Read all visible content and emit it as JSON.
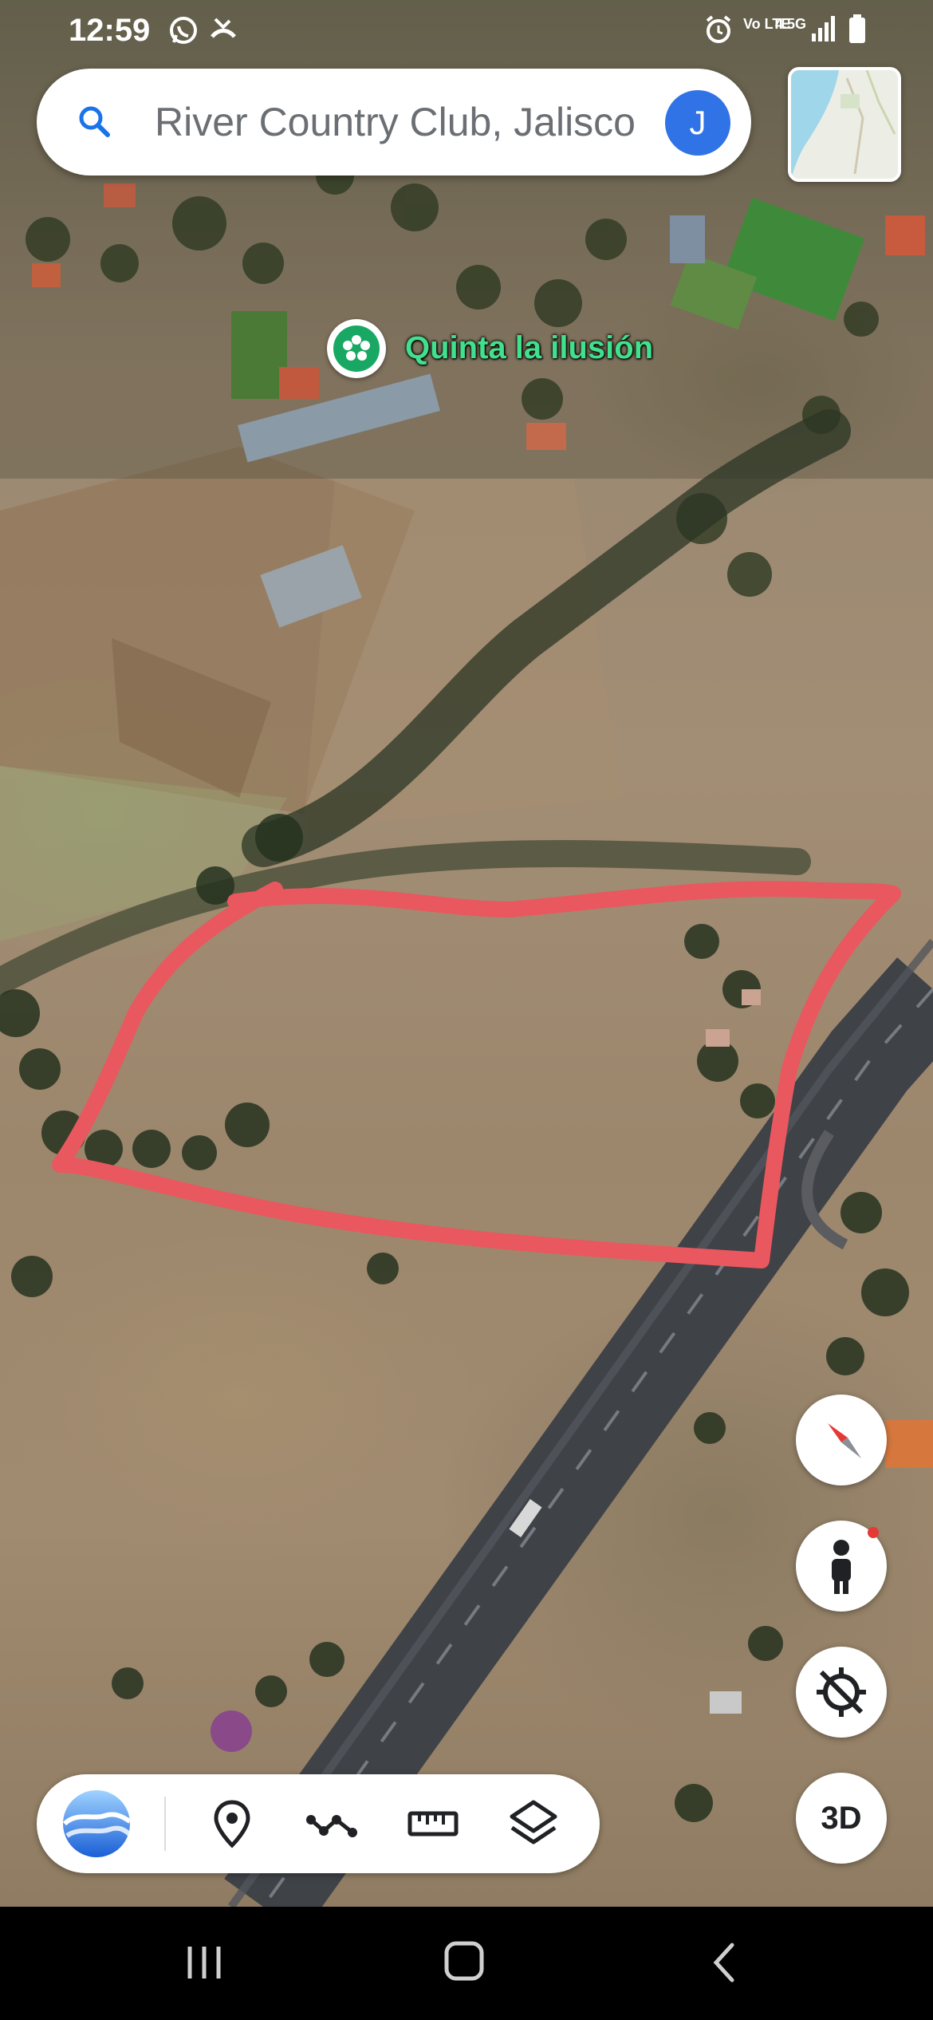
{
  "status_bar": {
    "time": "12:59",
    "network": "Vo LTE",
    "network_speed": "4.5G"
  },
  "search": {
    "text": "River Country Club, Jalisco",
    "account_initial": "J"
  },
  "map": {
    "place_label": "Quinta la ilusión",
    "place_pin_color": "#19a864",
    "annotation_color": "#e9585e"
  },
  "map_controls": {
    "compass_icon": "compass-icon",
    "pegman_icon": "person-icon",
    "location_icon": "location-crosshair-icon",
    "three_d_label": "3D"
  },
  "toolbar": {
    "items": [
      "earth-logo-icon",
      "place-pin-icon",
      "draw-path-icon",
      "ruler-icon",
      "layers-icon"
    ]
  },
  "nav_bar": {
    "items": [
      "recent-apps-icon",
      "home-icon",
      "back-icon"
    ]
  }
}
